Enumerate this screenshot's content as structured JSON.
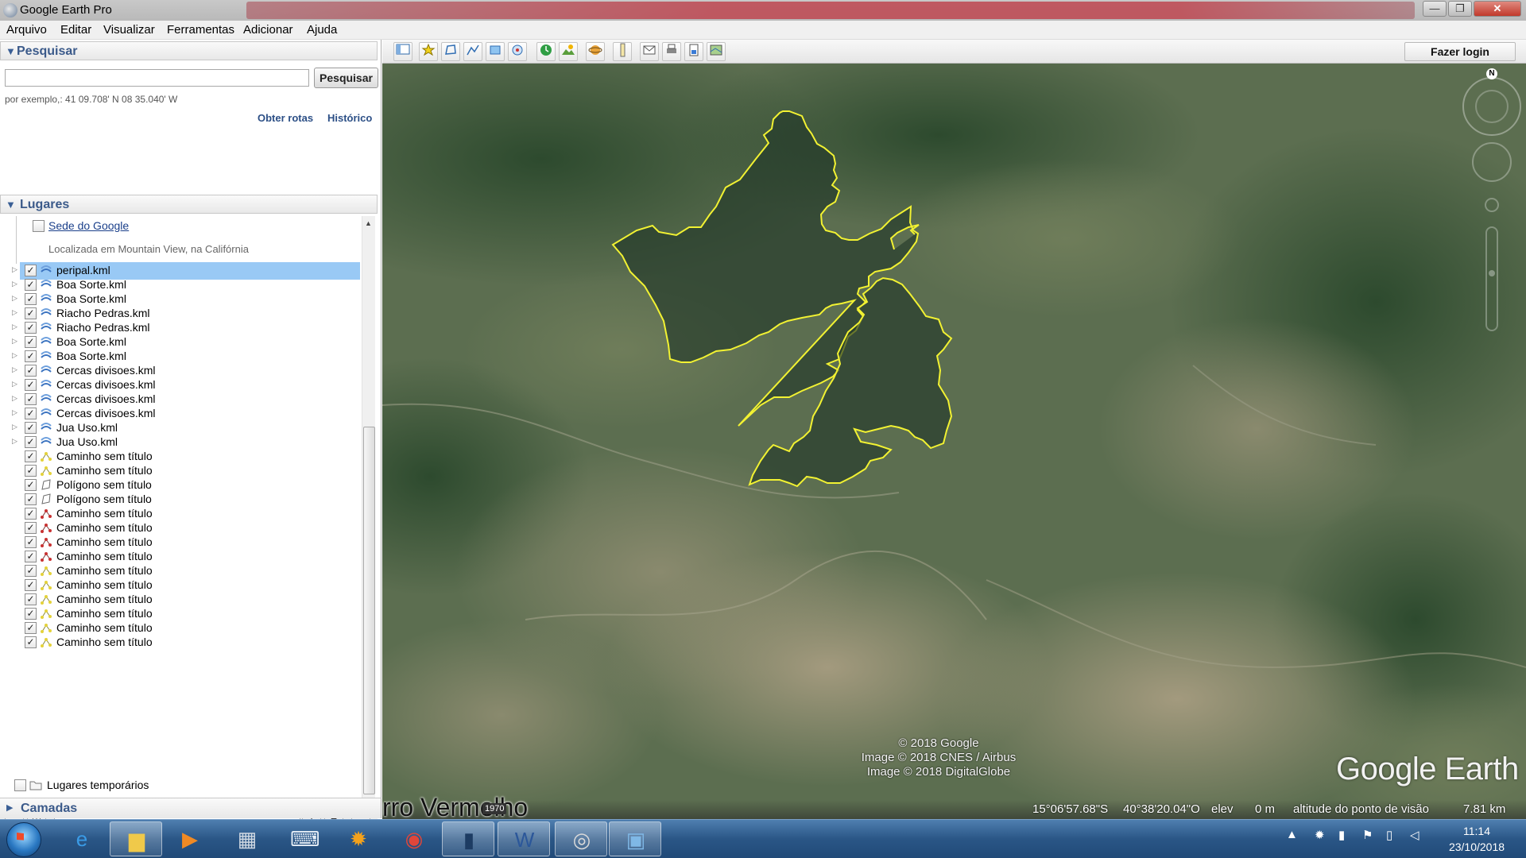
{
  "window": {
    "title": "Google Earth Pro"
  },
  "menu": [
    "Arquivo",
    "Editar",
    "Visualizar",
    "Ferramentas",
    "Adicionar",
    "Ajuda"
  ],
  "search": {
    "header": "Pesquisar",
    "placeholder": "",
    "button": "Pesquisar",
    "hint": "por exemplo,: 41 09.708' N 08 35.040' W",
    "link_routes": "Obter rotas",
    "link_history": "Histórico"
  },
  "places": {
    "header": "Lugares",
    "sede_label": "Sede do Google",
    "sede_desc": "Localizada em Mountain View, na Califórnia",
    "items": [
      {
        "name": "peripal.kml",
        "type": "kml",
        "checked": true,
        "selected": true
      },
      {
        "name": "Boa Sorte.kml",
        "type": "kml",
        "checked": true
      },
      {
        "name": "Boa Sorte.kml",
        "type": "kml",
        "checked": true
      },
      {
        "name": "Riacho Pedras.kml",
        "type": "kml",
        "checked": true
      },
      {
        "name": "Riacho Pedras.kml",
        "type": "kml",
        "checked": true
      },
      {
        "name": "Boa Sorte.kml",
        "type": "kml",
        "checked": true
      },
      {
        "name": "Boa Sorte.kml",
        "type": "kml",
        "checked": true
      },
      {
        "name": "Cercas divisoes.kml",
        "type": "kml",
        "checked": true
      },
      {
        "name": "Cercas divisoes.kml",
        "type": "kml",
        "checked": true
      },
      {
        "name": "Cercas divisoes.kml",
        "type": "kml",
        "checked": true
      },
      {
        "name": "Cercas divisoes.kml",
        "type": "kml",
        "checked": true
      },
      {
        "name": "Jua Uso.kml",
        "type": "kml",
        "checked": true
      },
      {
        "name": "Jua Uso.kml",
        "type": "kml",
        "checked": true
      },
      {
        "name": "Caminho sem título",
        "type": "path-yellow",
        "checked": true
      },
      {
        "name": "Caminho sem título",
        "type": "path-yellow",
        "checked": true
      },
      {
        "name": "Polígono sem título",
        "type": "polygon",
        "checked": true
      },
      {
        "name": "Polígono sem título",
        "type": "polygon",
        "checked": true
      },
      {
        "name": "Caminho sem título",
        "type": "path-red",
        "checked": true
      },
      {
        "name": "Caminho sem título",
        "type": "path-red",
        "checked": true
      },
      {
        "name": "Caminho sem título",
        "type": "path-red",
        "checked": true
      },
      {
        "name": "Caminho sem título",
        "type": "path-red",
        "checked": true
      },
      {
        "name": "Caminho sem título",
        "type": "path-yellow",
        "checked": true
      },
      {
        "name": "Caminho sem título",
        "type": "path-yellow",
        "checked": true
      },
      {
        "name": "Caminho sem título",
        "type": "path-yellow",
        "checked": true
      },
      {
        "name": "Caminho sem título",
        "type": "path-yellow",
        "checked": true
      },
      {
        "name": "Caminho sem título",
        "type": "path-yellow",
        "checked": true
      },
      {
        "name": "Caminho sem título",
        "type": "path-yellow",
        "checked": true
      }
    ],
    "temp_label": "Lugares temporários"
  },
  "layers": {
    "header": "Camadas"
  },
  "toolbar": {
    "login": "Fazer login",
    "icons": [
      "sidebar-toggle-icon",
      "placemark-icon",
      "polygon-icon",
      "path-icon",
      "image-overlay-icon",
      "record-tour-icon",
      "historical-imagery-icon",
      "sunlight-icon",
      "planets-icon",
      "ruler-icon",
      "email-icon",
      "print-icon",
      "save-image-icon",
      "view-in-maps-icon"
    ]
  },
  "map": {
    "place_label": "rro Vermelho",
    "imagery_year": "1970",
    "attribution": [
      "© 2018 Google",
      "Image © 2018 CNES / Airbus",
      "Image © 2018 DigitalGlobe"
    ],
    "logo": "Google Earth",
    "compass_north": "N",
    "status": {
      "lat": "15°06'57.68\"S",
      "lon": "40°38'20.04\"O",
      "elev_label": "elev",
      "elev_value": "0 m",
      "eye_label": "altitude do ponto de visão",
      "eye_value": "7.81 km"
    },
    "polygon_color": "#f2f232"
  },
  "taskbar": {
    "apps": [
      "internet-explorer-icon",
      "file-explorer-icon",
      "media-player-icon",
      "calculator-icon",
      "keyboard-icon",
      "settings-icon",
      "chrome-icon",
      "terminal-icon",
      "word-icon",
      "google-earth-pro-icon",
      "image-viewer-icon"
    ],
    "time": "11:14",
    "date": "23/10/2018"
  }
}
